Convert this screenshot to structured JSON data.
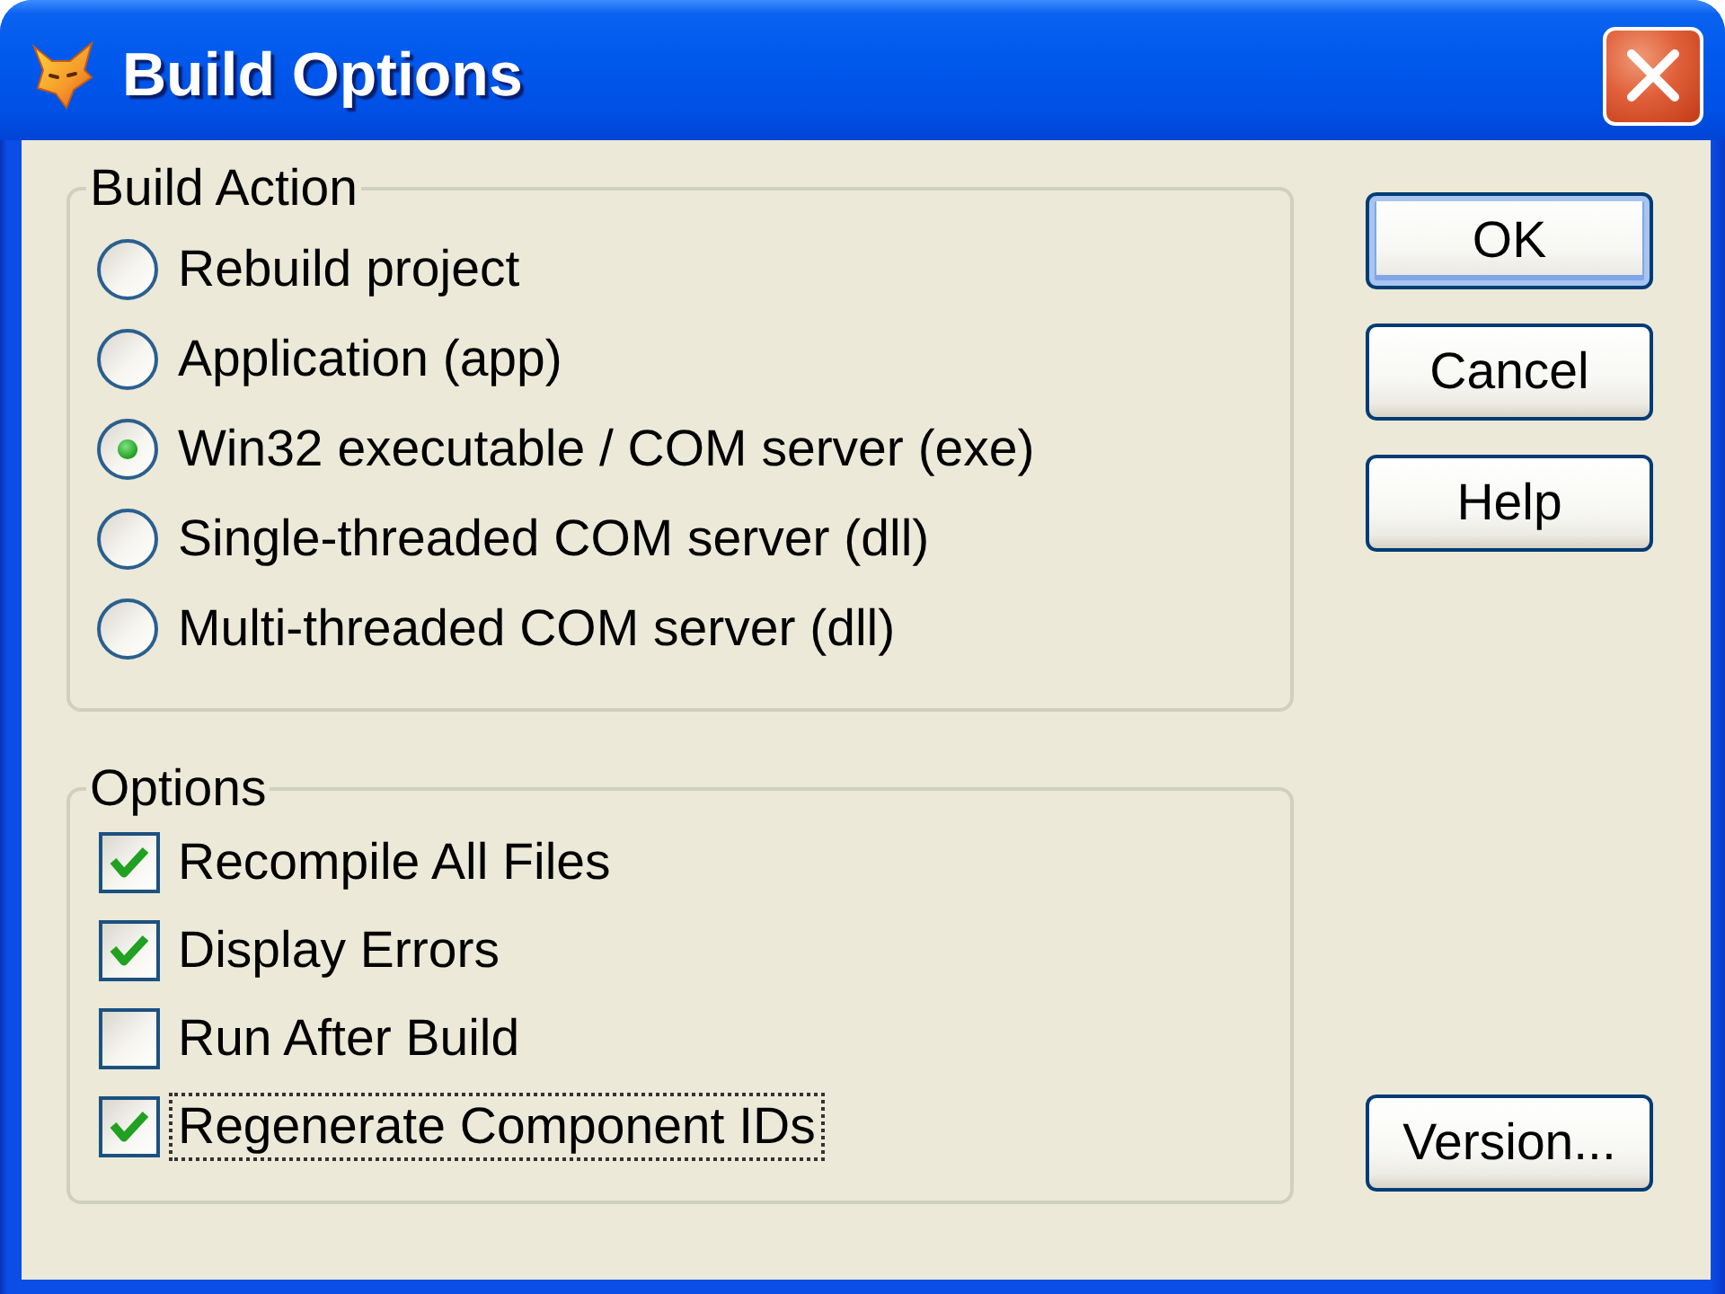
{
  "window": {
    "title": "Build Options"
  },
  "build_action": {
    "title": "Build Action",
    "options": [
      {
        "label": "Rebuild project",
        "selected": false
      },
      {
        "label": "Application (app)",
        "selected": false
      },
      {
        "label": "Win32 executable / COM server (exe)",
        "selected": true
      },
      {
        "label": "Single-threaded COM server (dll)",
        "selected": false
      },
      {
        "label": "Multi-threaded COM server (dll)",
        "selected": false
      }
    ]
  },
  "options": {
    "title": "Options",
    "items": [
      {
        "label": "Recompile All Files",
        "checked": true,
        "focused": false
      },
      {
        "label": "Display Errors",
        "checked": true,
        "focused": false
      },
      {
        "label": "Run After Build",
        "checked": false,
        "focused": false
      },
      {
        "label": "Regenerate Component IDs",
        "checked": true,
        "focused": true
      }
    ]
  },
  "buttons": [
    {
      "label": "OK",
      "default": true
    },
    {
      "label": "Cancel",
      "default": false
    },
    {
      "label": "Help",
      "default": false
    }
  ],
  "version_button": {
    "label": "Version...",
    "default": false
  }
}
